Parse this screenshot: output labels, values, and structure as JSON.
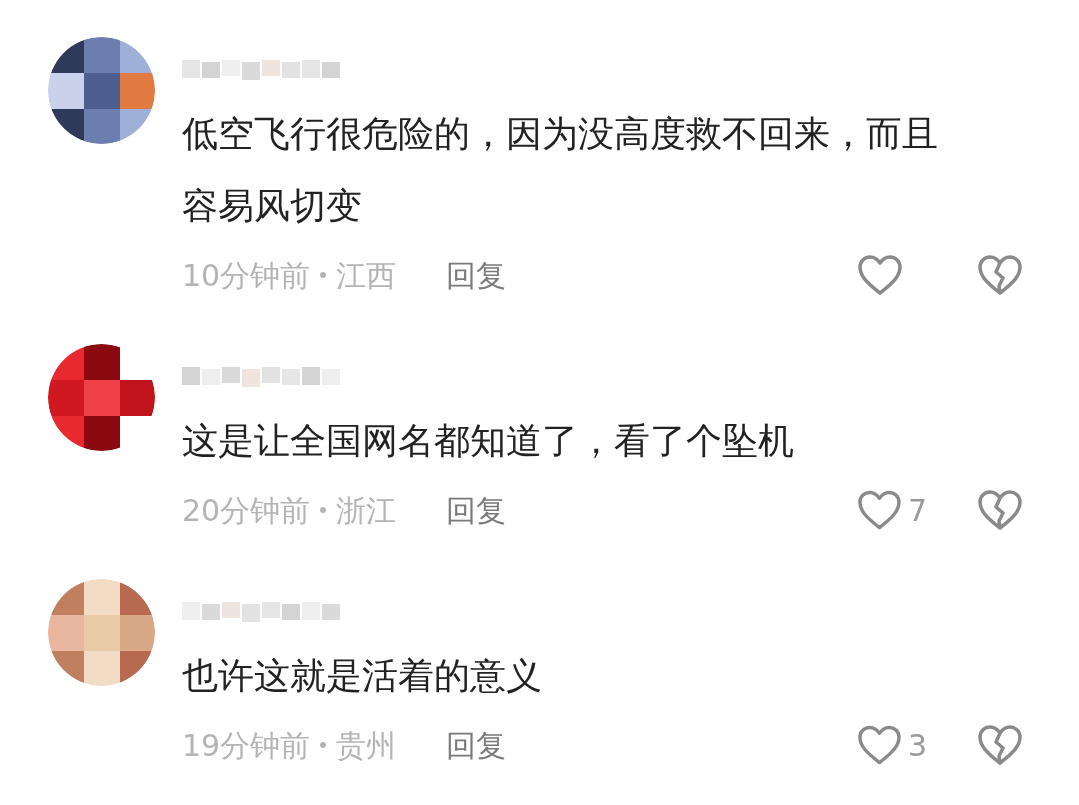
{
  "comments": [
    {
      "text": "低空飞行很危险的，因为没高度救不回来，而且容易风切变",
      "time": "10分钟前",
      "location": "江西",
      "reply": "回复"
    },
    {
      "text": "这是让全国网名都知道了，看了个坠机",
      "time": "20分钟前",
      "location": "浙江",
      "reply": "回复",
      "likes": "7"
    },
    {
      "text": "也许这就是活着的意义",
      "time": "19分钟前",
      "location": "贵州",
      "reply": "回复",
      "likes": "3"
    }
  ]
}
